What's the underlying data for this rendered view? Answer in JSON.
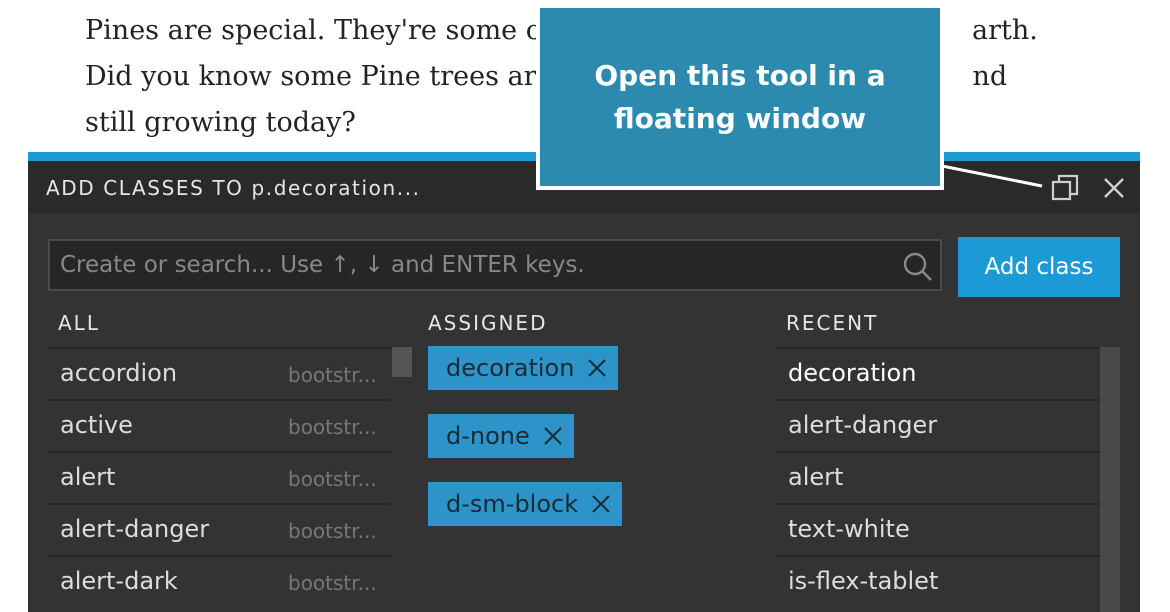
{
  "document": {
    "lines": [
      "Pines are special. They're some of",
      "Did you know some Pine trees are",
      "still growing today?"
    ],
    "line1_tail": "arth.",
    "line2_tail": "nd"
  },
  "callout": {
    "text": "Open this tool in a floating window"
  },
  "panel": {
    "accent_color": "#1c9ad6",
    "title": "ADD CLASSES TO p.decoration...",
    "float_icon": "float-window-icon",
    "close_icon": "close-icon",
    "search": {
      "placeholder": "Create or search... Use ↑, ↓ and ENTER keys.",
      "value": "",
      "icon": "search-icon"
    },
    "add_button_label": "Add class",
    "columns": {
      "all": "ALL",
      "assigned": "ASSIGNED",
      "recent": "RECENT"
    },
    "all_items": [
      {
        "name": "accordion",
        "source": "bootstr..."
      },
      {
        "name": "active",
        "source": "bootstr..."
      },
      {
        "name": "alert",
        "source": "bootstr..."
      },
      {
        "name": "alert-danger",
        "source": "bootstr..."
      },
      {
        "name": "alert-dark",
        "source": "bootstr..."
      }
    ],
    "assigned": [
      "decoration",
      "d-none",
      "d-sm-block"
    ],
    "recent": [
      "decoration",
      "alert-danger",
      "alert",
      "text-white",
      "is-flex-tablet"
    ]
  }
}
